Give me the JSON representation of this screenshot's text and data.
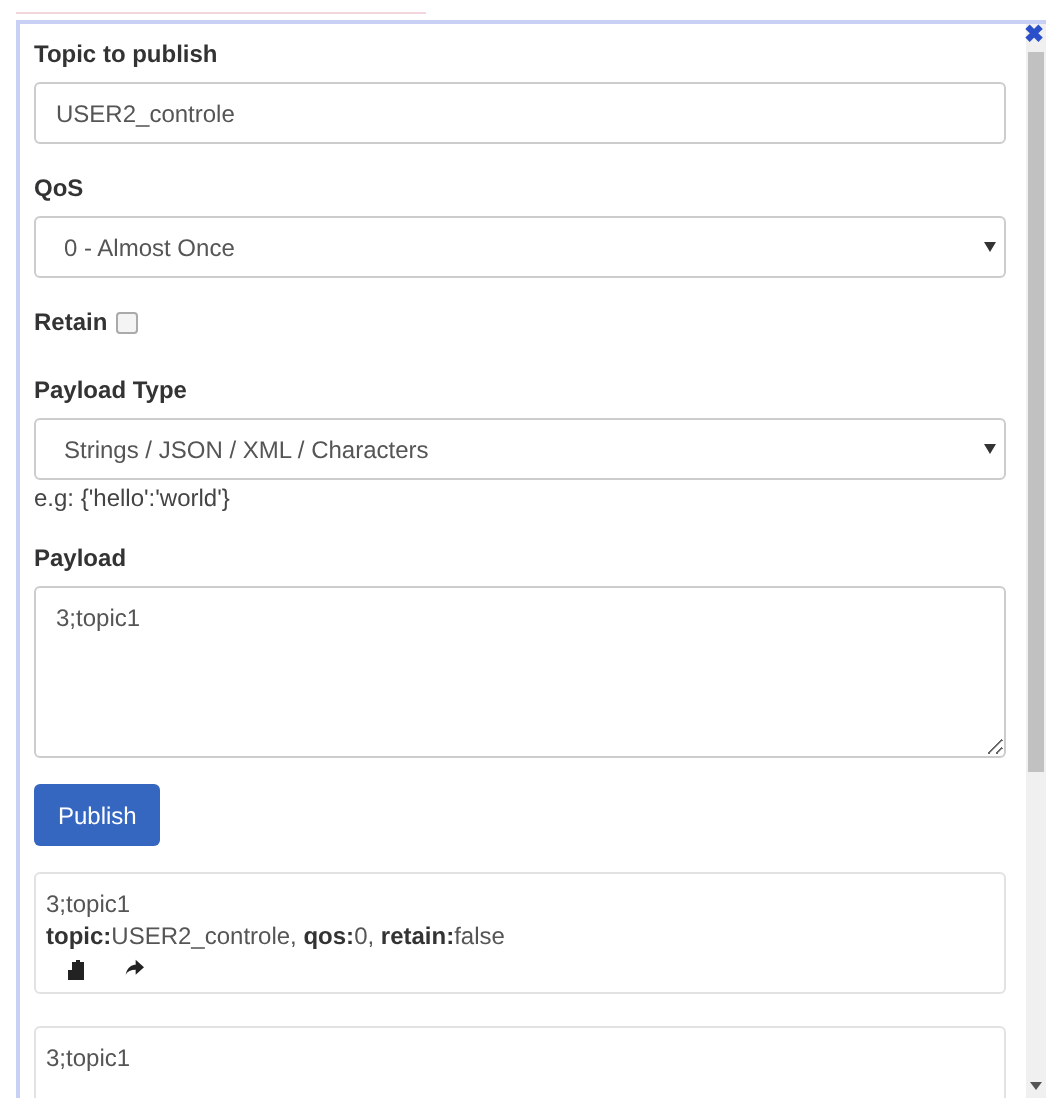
{
  "form": {
    "topic_label": "Topic to publish",
    "topic_value": "USER2_controle",
    "qos_label": "QoS",
    "qos_value": "0 - Almost Once",
    "retain_label": "Retain",
    "retain_checked": false,
    "payload_type_label": "Payload Type",
    "payload_type_value": "Strings / JSON / XML / Characters",
    "payload_hint": "e.g: {'hello':'world'}",
    "payload_label": "Payload",
    "payload_value": "3;topic1",
    "publish_button": "Publish"
  },
  "close_icon": "✖",
  "messages": [
    {
      "payload": "3;topic1",
      "meta": "**topic:**USER2_controle, **qos:**0, **retain:**false"
    },
    {
      "payload": "3;topic1"
    }
  ]
}
